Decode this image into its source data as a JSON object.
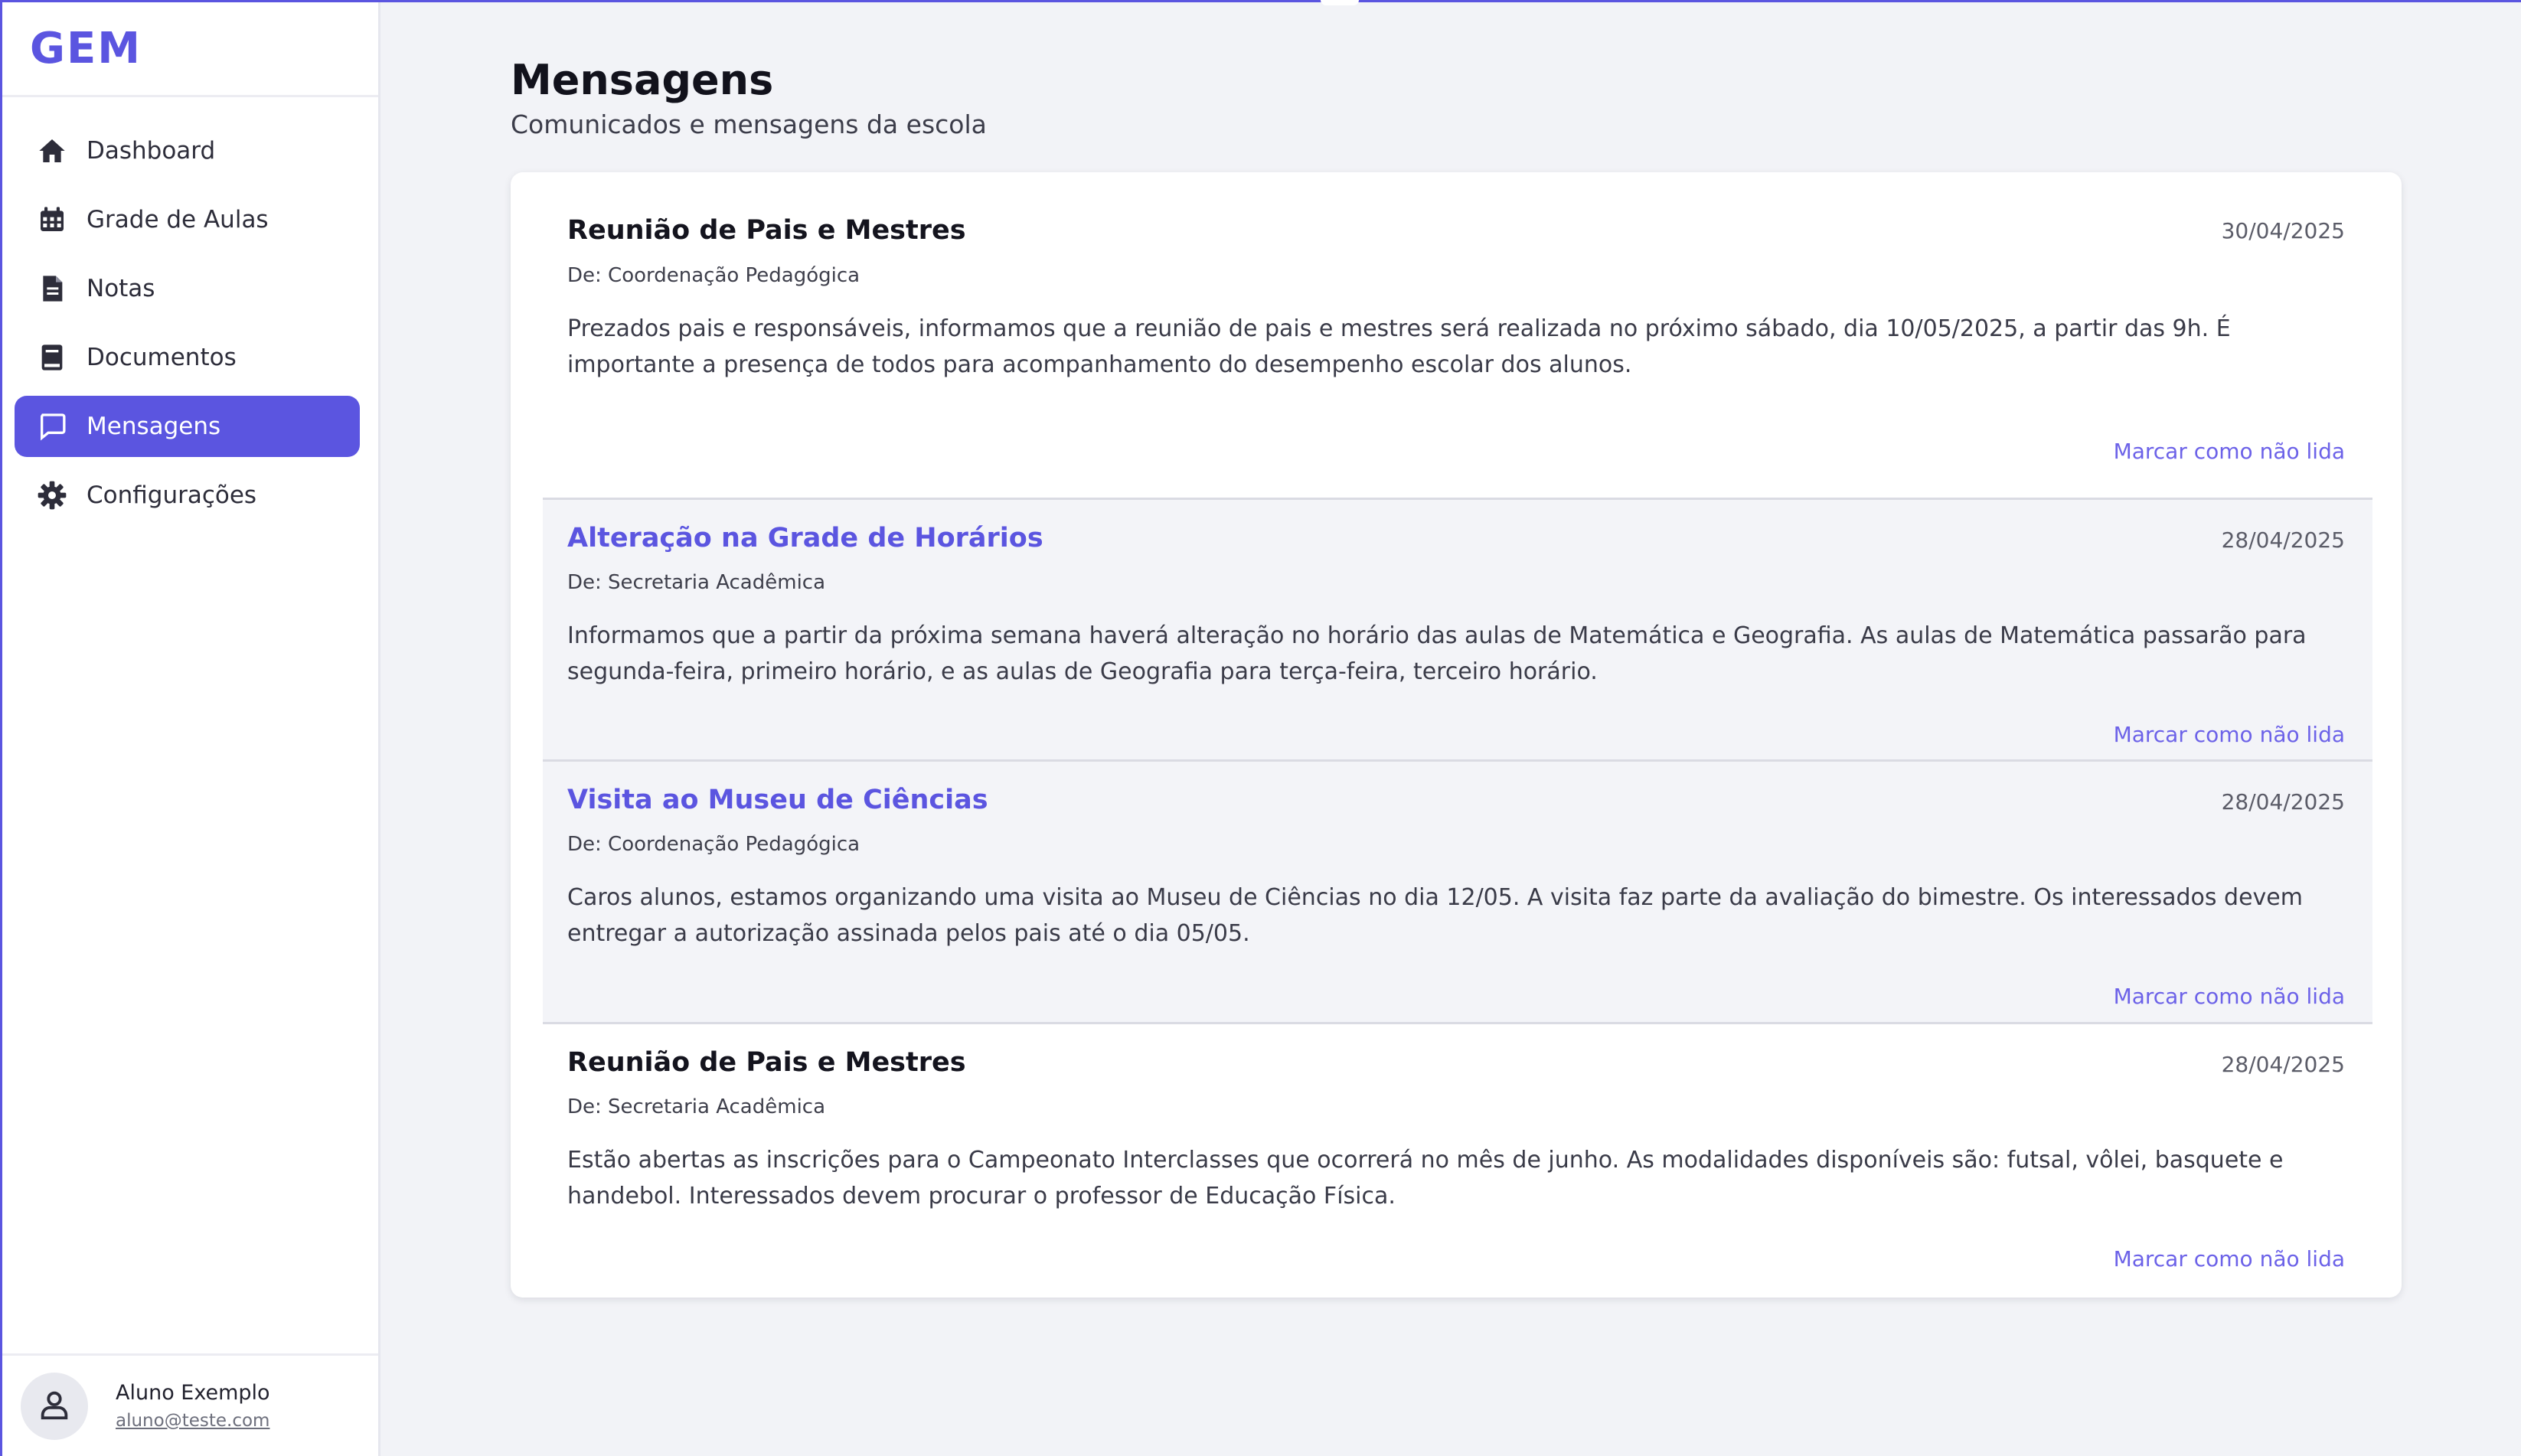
{
  "brand": {
    "logo": "GEM"
  },
  "sidebar": {
    "items": [
      {
        "label": "Dashboard",
        "icon": "home-icon"
      },
      {
        "label": "Grade de Aulas",
        "icon": "calendar-icon"
      },
      {
        "label": "Notas",
        "icon": "document-icon"
      },
      {
        "label": "Documentos",
        "icon": "book-icon"
      },
      {
        "label": "Mensagens",
        "icon": "message-icon",
        "active": true
      },
      {
        "label": "Configurações",
        "icon": "gear-icon"
      }
    ]
  },
  "user": {
    "name": "Aluno Exemplo",
    "email": "aluno@teste.com",
    "icon": "user-icon"
  },
  "page": {
    "title": "Mensagens",
    "subtitle": "Comunicados e mensagens da escola"
  },
  "messages": [
    {
      "title": "Reunião de Pais e Mestres",
      "date": "30/04/2025",
      "from": "De:  Coordenação Pedagógica",
      "body": "Prezados pais e responsáveis, informamos que a reunião de pais e mestres será  realizada no próximo sábado, dia 10/05/2025, a partir das 9h. É importante a presença de todos para acompanhamento do desempenho escolar dos alunos.",
      "action": "Marcar como não lida",
      "unread": false
    },
    {
      "title": "Alteração na Grade de Horários",
      "date": "28/04/2025",
      "from": "De:  Secretaria Acadêmica",
      "body": "Informamos que a partir da próxima semana haverá alteração no horário  das aulas de Matemática e Geografia. As aulas de Matemática passarão para segunda-feira, primeiro horário, e as aulas de Geografia para  terça-feira, terceiro horário.",
      "action": "Marcar como não lida",
      "unread": true
    },
    {
      "title": "Visita ao Museu de Ciências",
      "date": "28/04/2025",
      "from": "De:  Coordenação Pedagógica",
      "body": "Caros alunos, estamos organizando uma visita ao Museu de Ciências no dia 12/05. A visita faz parte da avaliação do bimestre. Os interessados devem entregar a autorização assinada pelos pais até o dia 05/05.",
      "action": "Marcar como não lida",
      "unread": true
    },
    {
      "title": "Reunião de Pais e Mestres",
      "date": "28/04/2025",
      "from": "De:  Secretaria Acadêmica",
      "body": "Estão abertas as inscrições para o Campeonato Interclasses que ocorrerá  no mês de junho. As modalidades disponíveis são: futsal, vôlei, basquete e handebol. Interessados devem procurar o professor de Educação Física.",
      "action": "Marcar como não lida",
      "unread": false
    }
  ],
  "colors": {
    "accent": "#5b55e0",
    "link": "#6c62e8",
    "background": "#f2f3f7",
    "unread_row": "#f3f4f8"
  }
}
